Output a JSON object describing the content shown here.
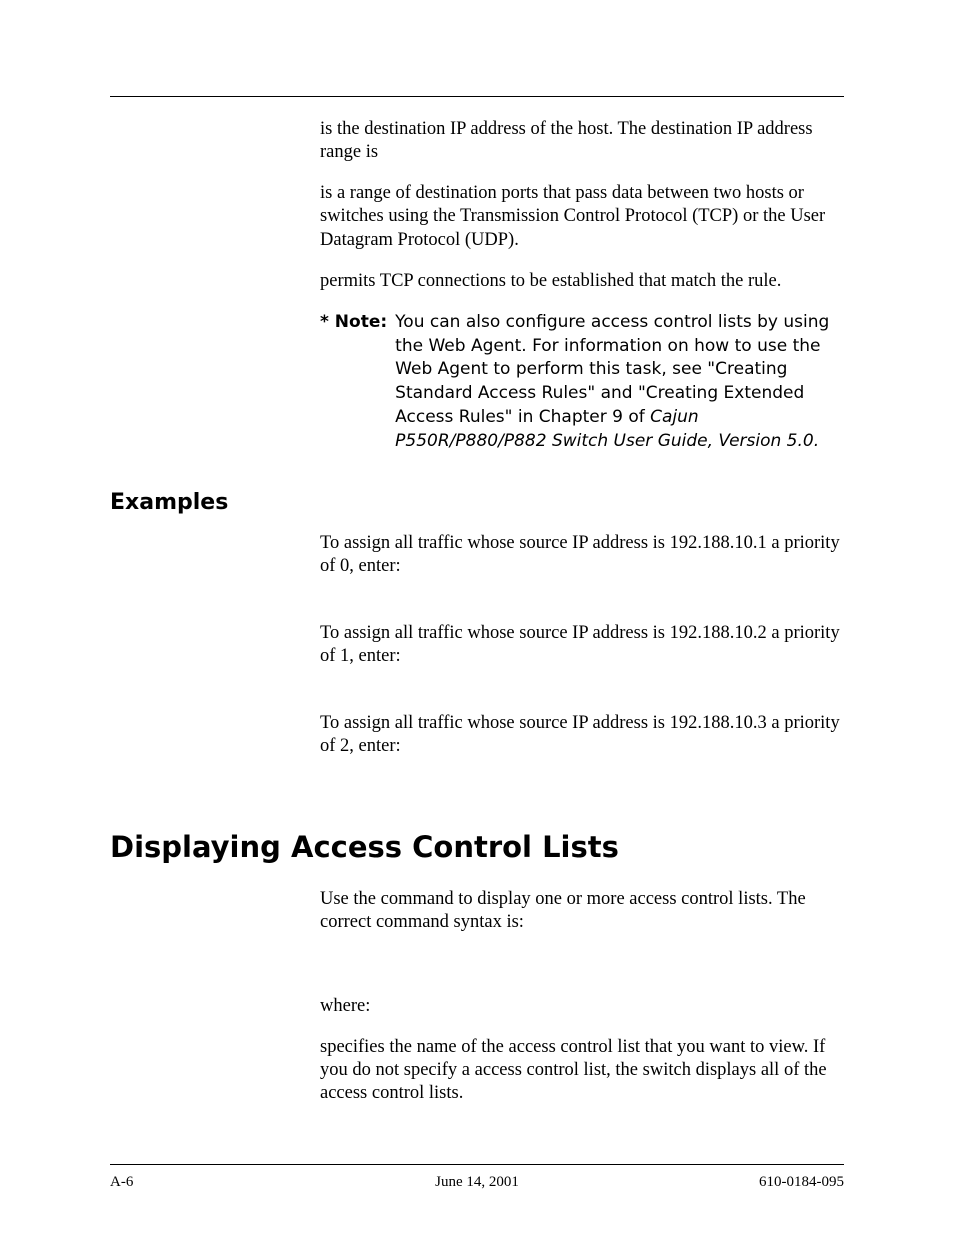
{
  "para_dest_ip": " is the destination IP address of the host. The destination IP address range is ",
  "para_dest_port_range": " is a range of destination ports that pass data between two hosts or switches using the Transmission Control Protocol (TCP) or the User Datagram Protocol (UDP).",
  "para_permits_tcp": " permits TCP connections to be established that match the rule.",
  "note": {
    "label": "* Note:",
    "text_a": "You can also configure access control lists by using the Web Agent. For information on how to use the Web Agent to perform this task, see \"Creating Standard Access Rules\" and \"Creating Extended Access Rules\" in Chapter 9 of ",
    "text_italic": "Cajun P550R/P880/P882 Switch User Guide, Version 5.0."
  },
  "examples_heading": "Examples",
  "examples": {
    "ex1": "To assign all traffic whose source IP address is 192.188.10.1 a priority of 0, enter:",
    "ex2": "To assign all traffic whose source IP address is 192.188.10.2 a priority of 1, enter:",
    "ex3": "To assign all traffic whose source IP address is 192.188.10.3 a priority of 2, enter:"
  },
  "title": "Displaying Access Control Lists",
  "display_intro_a": "Use the ",
  "display_intro_b": " command to display one or more access control lists. The correct command syntax is:",
  "where_label": "where:",
  "where_text": " specifies the name of the access control list that you want to view. If you do not specify a access control list, the switch displays all of the access control lists.",
  "footer": {
    "left": "A-6",
    "center": "June 14, 2001",
    "right": "610-0184-095"
  }
}
